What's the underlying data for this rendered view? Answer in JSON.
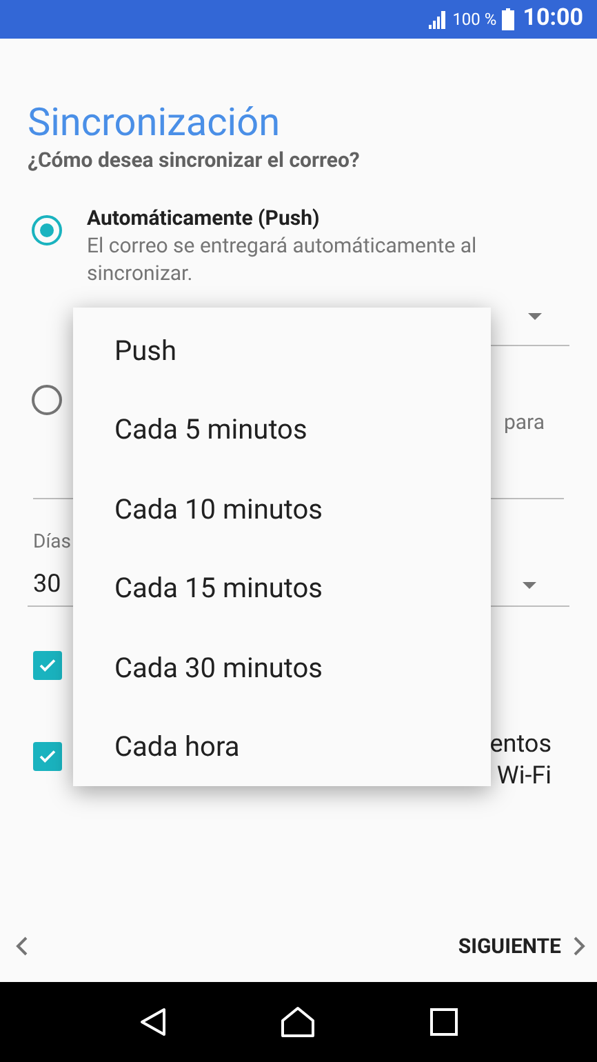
{
  "status_bar": {
    "battery": "100 %",
    "time": "10:00"
  },
  "title": "Sincronización",
  "subtitle": "¿Cómo desea sincronizar el correo?",
  "sync_options": [
    {
      "title": "Automáticamente (Push)",
      "description": "El correo se entregará automáticamente al sincronizar.",
      "selected": true
    },
    {
      "description": "para",
      "selected": false
    }
  ],
  "days_field": {
    "label": "Días",
    "value": "30"
  },
  "checkboxes": [
    {
      "checked": true
    },
    {
      "checked": true,
      "text_lines": [
        "entos",
        "Wi-Fi"
      ]
    }
  ],
  "menu": {
    "items": [
      "Push",
      "Cada 5 minutos",
      "Cada 10 minutos",
      "Cada 15 minutos",
      "Cada 30 minutos",
      "Cada hora"
    ]
  },
  "footer": {
    "next": "SIGUIENTE"
  }
}
